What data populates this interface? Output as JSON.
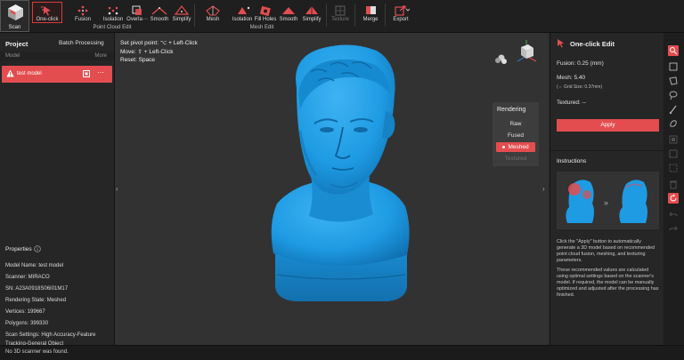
{
  "toolbar": {
    "scan": "Scan",
    "point_cloud": {
      "group_label": "Point Cloud Edit",
      "items": [
        "One-click",
        "Fusion",
        "Isolation",
        "Overla⋯",
        "Smooth",
        "Simplify"
      ]
    },
    "mesh": {
      "group_label": "Mesh Edit",
      "items": [
        "Mesh",
        "Isolation",
        "Fill Holes",
        "Smooth",
        "Simplify"
      ]
    },
    "texture": "Texture",
    "merge": "Merge",
    "export": "Export"
  },
  "left_panel": {
    "title": "Project",
    "batch_processing": "Batch Processing",
    "col_model": "Model",
    "col_more": "More",
    "model_name": "test model",
    "properties_title": "Properties",
    "properties": [
      "Model Name:  test model",
      "Scanner:  MIRACO",
      "SN:  A23A0918S06I01M17",
      "Rendering State:  Meshed",
      "Vertices:  199667",
      "Polygons:  399330",
      "Scan Settings:  High Accuracy-Feature",
      "Tracking-General Object"
    ]
  },
  "viewport": {
    "hints": [
      "Set pivot point:  ⌥ + Left-Click",
      "Move:  ⇧ + Left-Click",
      "Reset:  Space"
    ],
    "rendering": {
      "title": "Rendering",
      "options": [
        "Raw",
        "Fused",
        "Meshed",
        "Textured"
      ],
      "selected": "Meshed"
    },
    "model_color": "#1e9be3"
  },
  "right_panel": {
    "title": "One-click Edit",
    "fusion": "Fusion:   0.25 (mm)",
    "mesh": "Mesh:  5.40",
    "grid_size": "(⇔ Grid Size: 0.37mm)",
    "textured": "Textured:  --",
    "apply": "Apply",
    "instructions_title": "Instructions",
    "instructions_p1": "Click the \"Apply\" button to automatically generate a 3D model based on recommended point cloud fusion, meshing, and texturing parameters.",
    "instructions_p2": "These recommended values are calculated using optimal settings based on the scanner's model. If required, the model can be manually optimized and adjusted after the processing has finished."
  },
  "statusbar": {
    "message": "No 3D scanner was found."
  },
  "colors": {
    "accent": "#e34d4f",
    "model_blue": "#1e9be3",
    "background": "#2b2b2b"
  }
}
